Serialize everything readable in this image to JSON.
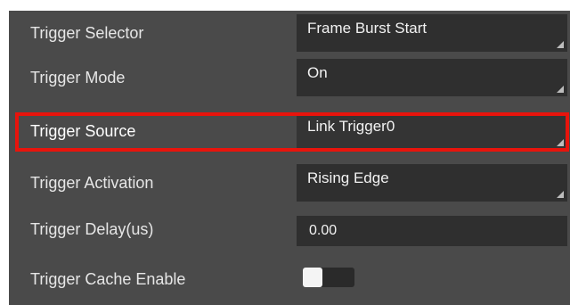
{
  "rows": [
    {
      "label": "Trigger Selector",
      "value": "Frame Burst Start",
      "control": "dropdown"
    },
    {
      "label": "Trigger Mode",
      "value": "On",
      "control": "dropdown"
    },
    {
      "label": "Trigger Source",
      "value": "Link Trigger0",
      "control": "dropdown",
      "highlighted": true
    },
    {
      "label": "Trigger Activation",
      "value": "Rising Edge",
      "control": "dropdown"
    },
    {
      "label": "Trigger Delay(us)",
      "value": "0.00",
      "control": "text-input"
    },
    {
      "label": "Trigger Cache Enable",
      "control": "toggle",
      "state": "off"
    }
  ],
  "colors": {
    "panel_background": "#4a4a4a",
    "field_background": "#2f2f2f",
    "label_text": "#e6e6e6",
    "highlight_border": "#e8140c"
  }
}
